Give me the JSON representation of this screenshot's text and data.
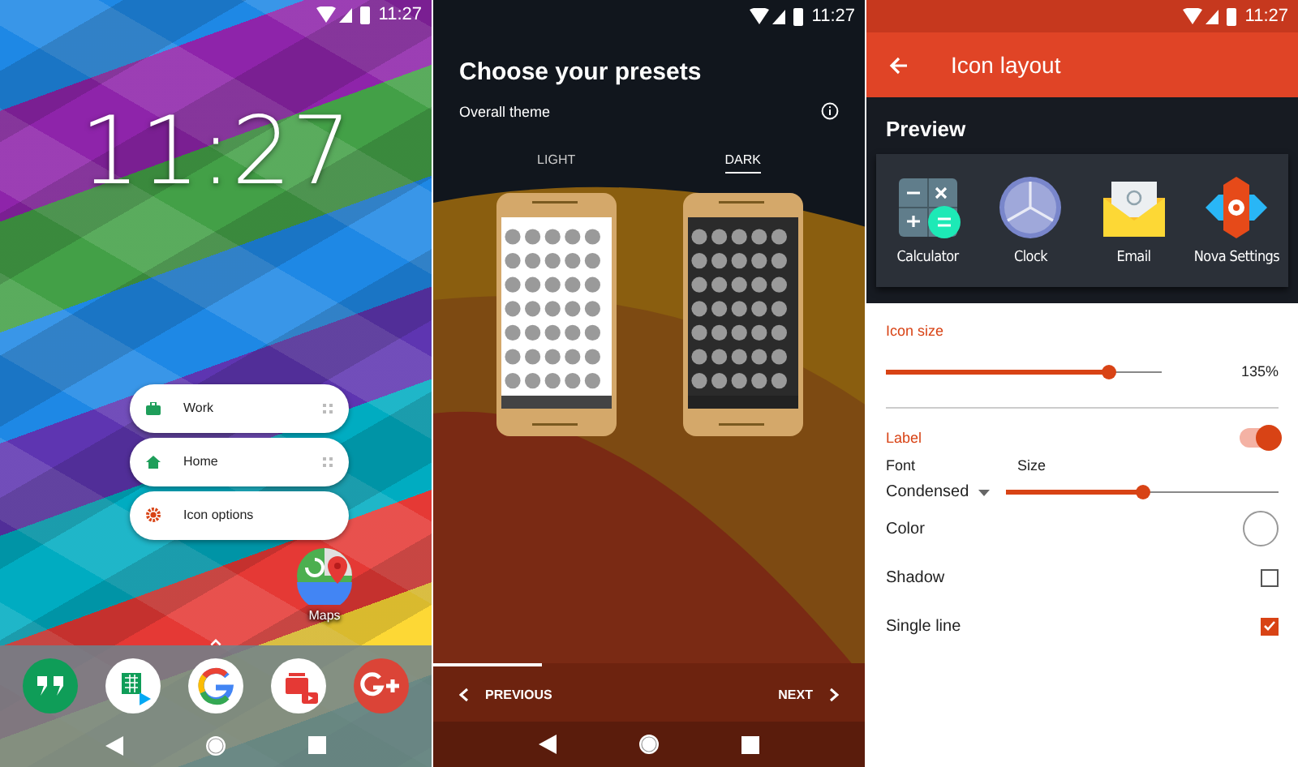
{
  "home": {
    "status_time": "11:27",
    "clock": "11:27",
    "menu": [
      {
        "label": "Work",
        "kind": "work"
      },
      {
        "label": "Home",
        "kind": "home"
      },
      {
        "label": "Icon options",
        "kind": "options"
      }
    ],
    "app": {
      "label": "Maps"
    }
  },
  "presets": {
    "status_time": "11:27",
    "title": "Choose your presets",
    "subtitle": "Overall theme",
    "tabs": [
      {
        "label": "LIGHT",
        "selected": false,
        "kind": "light"
      },
      {
        "label": "DARK",
        "selected": true,
        "kind": "dark"
      }
    ],
    "progress": {
      "level": 0.25
    },
    "previous": "PREVIOUS",
    "next": "NEXT"
  },
  "settings": {
    "status_time": "11:27",
    "title": "Icon layout",
    "preview": {
      "title": "Preview",
      "apps": [
        {
          "label": "Calculator"
        },
        {
          "label": "Clock"
        },
        {
          "label": "Email"
        },
        {
          "label": "Nova Settings"
        }
      ]
    },
    "icon_size": {
      "heading": "Icon size",
      "level": 0.81,
      "reading": "135%"
    },
    "label": {
      "heading": "Label",
      "on": true,
      "font_label": "Font",
      "size_label": "Size",
      "font": "Condensed",
      "size_slider": {
        "level": 0.5
      }
    },
    "options": [
      {
        "label": "Color",
        "kind": "color",
        "color": "#ffffff"
      },
      {
        "label": "Shadow",
        "kind": "checkbox",
        "checked": false
      },
      {
        "label": "Single line",
        "kind": "checkbox",
        "checked": true
      }
    ]
  }
}
